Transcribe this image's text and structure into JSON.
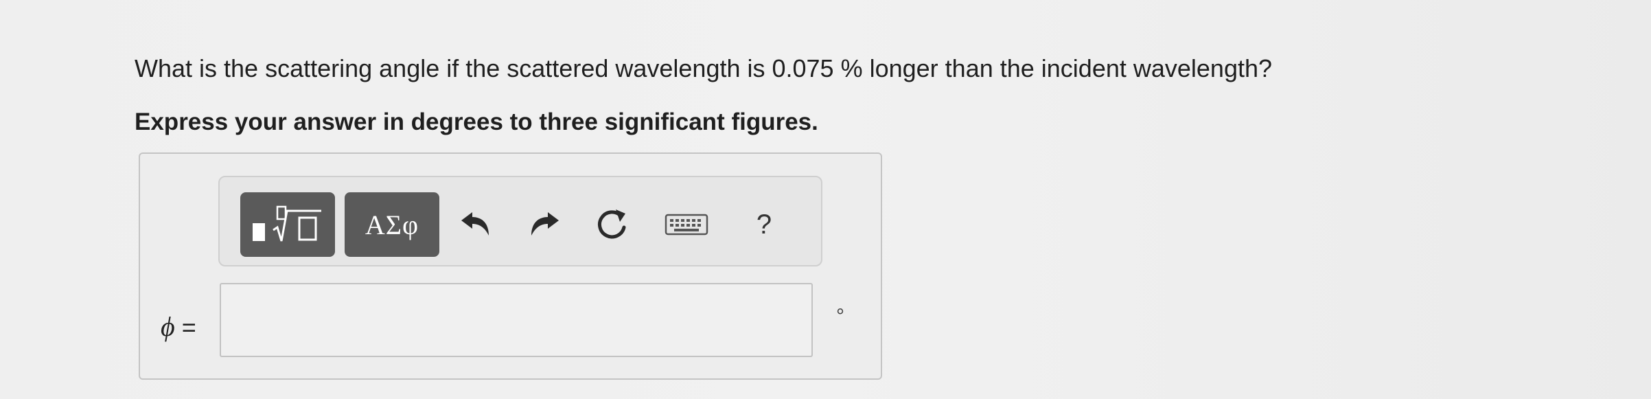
{
  "question": {
    "text": "What is the scattering angle if the scattered wavelength is 0.075 % longer than the incident wavelength?"
  },
  "instruction": {
    "text": "Express your answer in degrees to three significant figures."
  },
  "toolbar": {
    "templates_icon": "templates-radical-icon",
    "greek_label": "ΑΣφ",
    "undo_icon": "undo-icon",
    "redo_icon": "redo-icon",
    "reset_icon": "reset-icon",
    "keyboard_icon": "keyboard-icon",
    "help_label": "?",
    "button_color": "#5a5a5a"
  },
  "answer": {
    "variable_symbol": "ϕ",
    "equals": "=",
    "value": "",
    "unit": "°"
  }
}
